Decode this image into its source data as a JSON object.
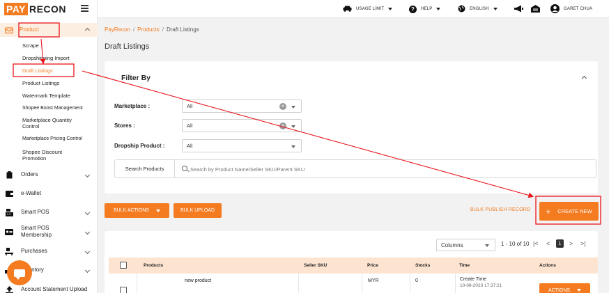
{
  "brand": {
    "logo_box": "PAY",
    "logo_rest": "RECON"
  },
  "topbar": {
    "usage_limit": "USAGE LIMIT",
    "help": "HELP",
    "language": "ENGLISH",
    "user": "GARET CHUA"
  },
  "sidebar": {
    "product": "Product",
    "sub_items": [
      "Scrape",
      "Dropshipping Import",
      "Draft Listings",
      "Product Listings",
      "Watermark Template",
      "Shopee Boost Management",
      "Marketplace Quantity Control",
      "Marketplace Pricing Control",
      "Shopee Discount Promotion"
    ],
    "items": [
      "Orders",
      "e-Wallet",
      "Smart POS",
      "Smart POS Membership",
      "Purchases",
      "Inventory",
      "Account Statement Upload"
    ]
  },
  "breadcrumb": {
    "home": "PayRecon",
    "section": "Products",
    "current": "Draft Listings"
  },
  "page_title": "Draft Listings",
  "filter": {
    "title": "Filter By",
    "marketplace_label": "Marketplace :",
    "marketplace_value": "All",
    "stores_label": "Stores :",
    "stores_value": "All",
    "dropship_label": "Dropship Product :",
    "dropship_value": "All",
    "search_label": "Search Products",
    "search_placeholder": "Search by Product Name/Seller SKU/Parent SKU"
  },
  "actions": {
    "bulk_actions": "BULK ACTIONS",
    "bulk_upload": "BULK UPLOAD",
    "bulk_publish": "BULK PUBLISH RECORD",
    "create_new": "CREATE NEW"
  },
  "list": {
    "columns_label": "Columns",
    "range": "1 - 10 of 10",
    "current_page": "1",
    "headers": [
      "Products",
      "Seller SKU",
      "Price",
      "Stocks",
      "Time",
      "Actions"
    ],
    "rows": [
      {
        "product": "new product",
        "sku": "",
        "price": "MYR",
        "stocks": "0",
        "time_label": "Create Time",
        "time_value": "10-08-2023 17:37:21",
        "action": "ACTIONS"
      }
    ]
  },
  "colors": {
    "accent": "#f47b20",
    "annotation": "#e8141a"
  }
}
